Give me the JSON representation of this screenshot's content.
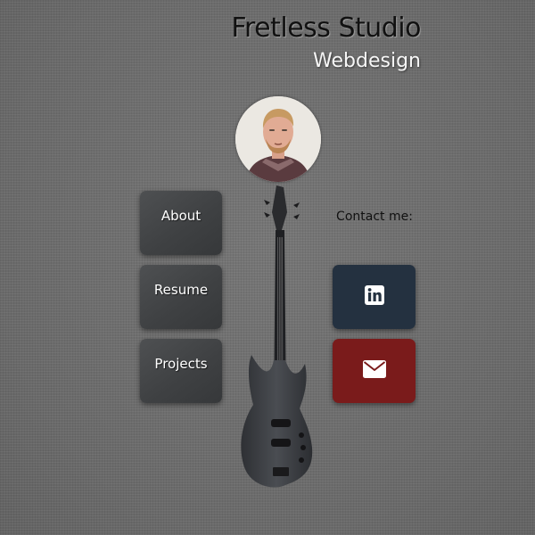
{
  "header": {
    "title": "Fretless Studio",
    "subtitle": "Webdesign"
  },
  "nav": {
    "about": "About",
    "resume": "Resume",
    "projects": "Projects"
  },
  "contact": {
    "label": "Contact me:",
    "links": [
      {
        "name": "linkedin",
        "icon": "linkedin-icon",
        "color": "#243140"
      },
      {
        "name": "email",
        "icon": "envelope-icon",
        "color": "#7a1b1b"
      }
    ]
  },
  "colors": {
    "background": "#6f6f6f",
    "nav_button": "#434547",
    "linkedin": "#243140",
    "email": "#7a1b1b"
  }
}
